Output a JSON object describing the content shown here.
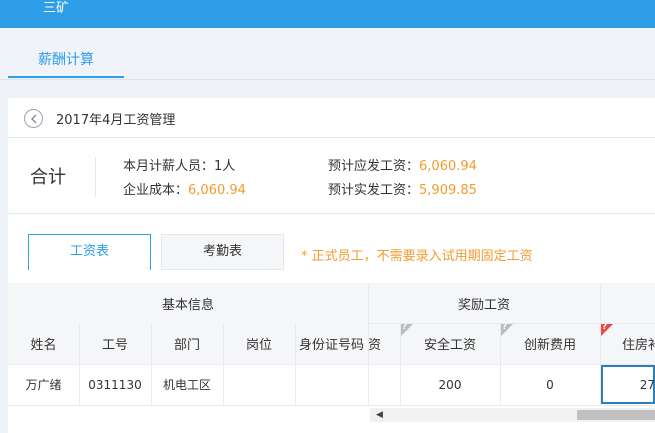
{
  "app": {
    "title": "三矿"
  },
  "nav": {
    "tab_label": "薪酬计算"
  },
  "panel": {
    "title": "2017年4月工资管理"
  },
  "summary": {
    "label": "合计",
    "staff_count_label": "本月计薪人员：",
    "staff_count_value": "1人",
    "cost_label": "企业成本：",
    "cost_value": "6,060.94",
    "payable_label": "预计应发工资：",
    "payable_value": "6,060.94",
    "actual_label": "预计实发工资：",
    "actual_value": "5,909.85"
  },
  "tabs": [
    {
      "label": "工资表",
      "active": true
    },
    {
      "label": "考勤表",
      "active": false
    }
  ],
  "notice": "* 正式员工，不需要录入试用期固定工资",
  "table": {
    "group_headers": [
      "基本信息",
      "奖励工资"
    ],
    "columns": [
      "姓名",
      "工号",
      "部门",
      "岗位",
      "身份证号码",
      "资",
      "安全工资",
      "创新费用",
      "住房补"
    ],
    "rows": [
      {
        "name": "万广绪",
        "emp_id": "0311130",
        "dept": "机电工区",
        "position": "",
        "id_card": "",
        "wage": "",
        "safety_pay": "200",
        "innovation": "0",
        "housing": "27"
      }
    ]
  },
  "colors": {
    "accent": "#2e9ee9",
    "highlight": "#f39b30",
    "help_gray": "#b7bcc2",
    "help_red": "#e84a4a"
  },
  "icons": {
    "back": "chevron-left-circle",
    "help": "question-corner"
  }
}
